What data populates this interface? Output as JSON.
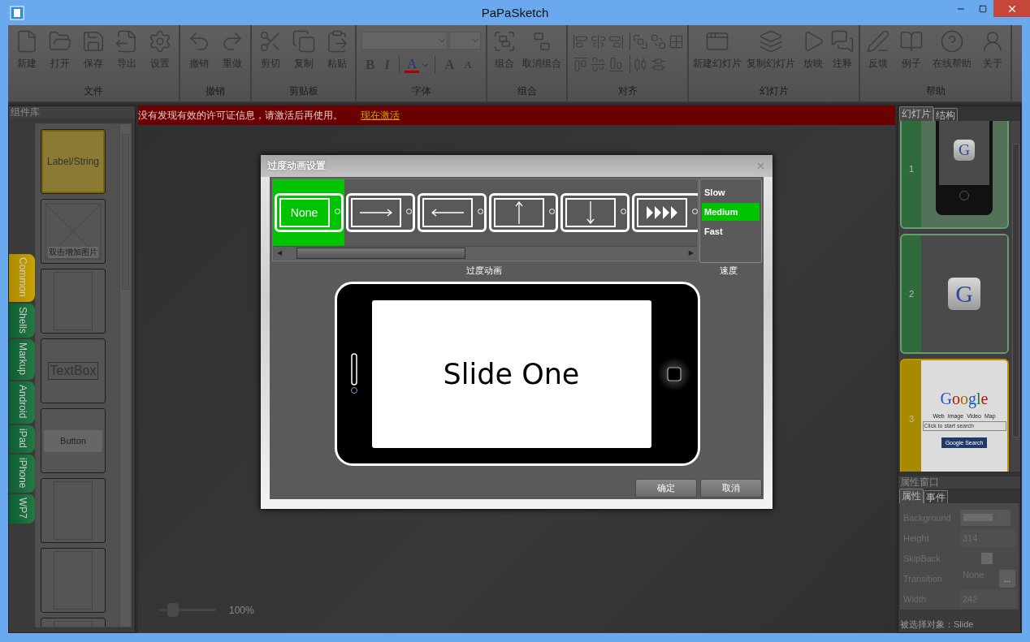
{
  "window": {
    "title": "PaPaSketch"
  },
  "ribbon": {
    "groups": [
      {
        "kind": "buttons",
        "label": "文件",
        "buttons": [
          "新建",
          "打开",
          "保存",
          "导出",
          "设置"
        ]
      },
      {
        "kind": "buttons",
        "label": "撤销",
        "buttons": [
          "撤销",
          "重做"
        ]
      },
      {
        "kind": "buttons",
        "label": "剪贴板",
        "buttons": [
          "剪切",
          "复制",
          "粘贴"
        ]
      },
      {
        "kind": "font",
        "label": "字体",
        "font": {
          "bold": "B",
          "italic": "I",
          "text_color_button": "A",
          "grow": "A",
          "shrink": "A"
        }
      },
      {
        "kind": "buttons",
        "label": "组合",
        "buttons": [
          "组合",
          "取消组合"
        ]
      },
      {
        "kind": "align",
        "label": "对齐"
      },
      {
        "kind": "buttons",
        "label": "幻灯片",
        "buttons": [
          "新建幻灯片",
          "复制幻灯片",
          "放映",
          "注释"
        ]
      },
      {
        "kind": "buttons",
        "label": "帮助",
        "buttons": [
          "反馈",
          "例子",
          "在线帮助",
          "关于"
        ]
      }
    ]
  },
  "library": {
    "title": "组件库",
    "tabs": [
      {
        "label": "Common",
        "selected": true
      },
      {
        "label": "Shells",
        "selected": false
      },
      {
        "label": "Markup",
        "selected": false
      },
      {
        "label": "Android",
        "selected": false
      },
      {
        "label": "iPad",
        "selected": false
      },
      {
        "label": "iPhone",
        "selected": false
      },
      {
        "label": "WP7",
        "selected": false
      }
    ],
    "items": [
      {
        "kind": "label",
        "text": "Label/String"
      },
      {
        "kind": "image",
        "text": "双击增加图片"
      },
      {
        "kind": "page"
      },
      {
        "kind": "textbox",
        "text": "TextBox"
      },
      {
        "kind": "button",
        "text": "Button"
      },
      {
        "kind": "page"
      },
      {
        "kind": "page"
      },
      {
        "kind": "page"
      }
    ]
  },
  "banner": {
    "message": "没有发现有效的许可证信息，请激活后再使用。",
    "link": "现在激活"
  },
  "dialog": {
    "title": "过度动画设置",
    "transitions": [
      {
        "kind": "none",
        "label": "None",
        "selected": true
      },
      {
        "kind": "right",
        "selected": false
      },
      {
        "kind": "left",
        "selected": false
      },
      {
        "kind": "up",
        "selected": false
      },
      {
        "kind": "down",
        "selected": false
      },
      {
        "kind": "fade",
        "selected": false
      }
    ],
    "scroll_arrows": [
      "◀",
      "▶"
    ],
    "transitions_label": "过度动画",
    "speeds": [
      {
        "label": "Slow",
        "selected": false
      },
      {
        "label": "Medium",
        "selected": true
      },
      {
        "label": "Fast",
        "selected": false
      }
    ],
    "speed_label": "速度",
    "preview": {
      "text": "Slide One"
    },
    "buttons": [
      "确定",
      "取消"
    ]
  },
  "zoom": {
    "level": 0.24,
    "reading": "100%"
  },
  "slides_panel": {
    "tabs": [
      {
        "label": "幻灯片",
        "selected": true
      },
      {
        "label": "结构",
        "selected": false
      }
    ],
    "slides": [
      {
        "number": "1",
        "kind": "phone",
        "logo": "G",
        "selected": false
      },
      {
        "number": "2",
        "kind": "icon",
        "logo": "G",
        "selected": false
      },
      {
        "number": "3",
        "kind": "page",
        "logo": "Google",
        "links": [
          "Web",
          "Image",
          "Video",
          "Map"
        ],
        "placeholder": "Click to start search",
        "button": "Google Search",
        "selected": true
      }
    ]
  },
  "properties": {
    "title": "属性窗口",
    "tabs": [
      {
        "label": "属性",
        "selected": true
      },
      {
        "label": "事件",
        "selected": false
      }
    ],
    "rows": [
      {
        "kind": "color",
        "name": "Background"
      },
      {
        "kind": "text",
        "name": "Height",
        "value": "314"
      },
      {
        "kind": "checkbox",
        "name": "SkipBack",
        "checked": false
      },
      {
        "kind": "picker",
        "name": "Transition",
        "value": "None",
        "button": "..."
      },
      {
        "kind": "text",
        "name": "Width",
        "value": "242"
      }
    ]
  },
  "status": "被选择对象：Slide"
}
